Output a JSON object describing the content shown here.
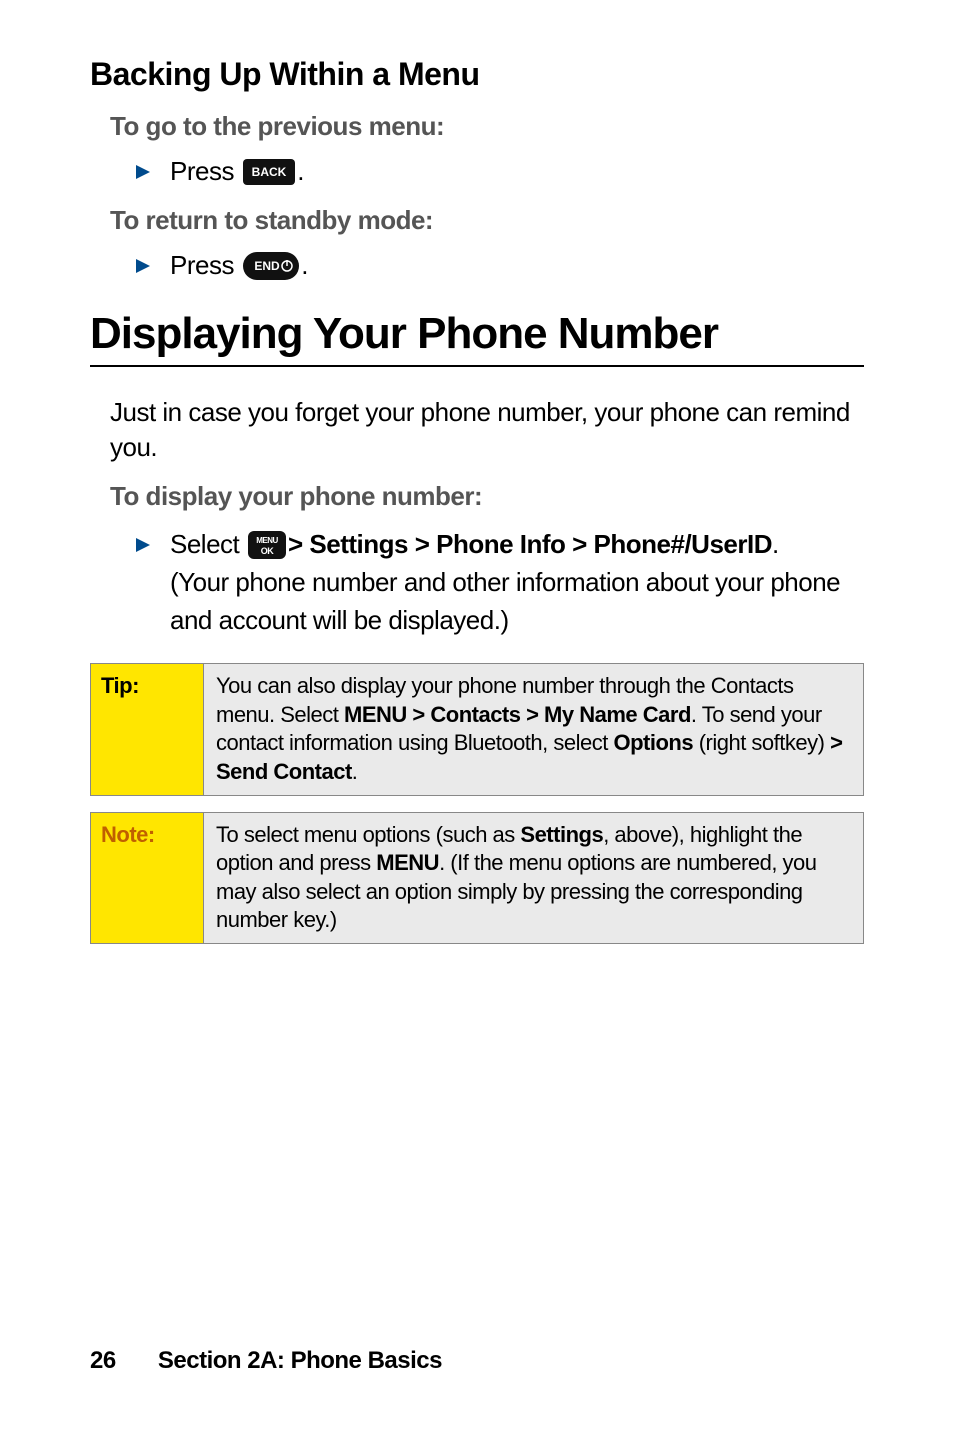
{
  "h3": "Backing Up Within a Menu",
  "prev_label": "To go to the previous menu:",
  "press_word": "Press",
  "period": ".",
  "standby_label": "To return to standby mode:",
  "h1": "Displaying Your Phone Number",
  "intro": "Just in case you forget your phone number, your phone can remind you.",
  "display_label": "To display your phone number:",
  "select_word": "Select",
  "select_path": " > Settings > Phone Info > Phone#/UserID",
  "select_tail": "(Your phone number and other information about your phone and account will be displayed.)",
  "tip": {
    "label": "Tip:",
    "t1": "You can also display your phone number through the Contacts menu. Select ",
    "b1": "MENU > Contacts > My Name Card",
    "t2": ". To send your contact information using Bluetooth, select ",
    "b2": "Options",
    "t3": " (right softkey) ",
    "b3": "> Send Contact",
    "t4": "."
  },
  "note": {
    "label": "Note:",
    "t1": "To select menu options (such as ",
    "b1": "Settings",
    "t2": ", above), highlight the option and press ",
    "b2": "MENU",
    "t3": ". (If the menu options are numbered, you may also select an option simply by pressing the corresponding number key.)"
  },
  "footer": {
    "page": "26",
    "section": "Section 2A: Phone Basics"
  },
  "icons": {
    "back": "BACK",
    "end": "END",
    "menu_top": "MENU",
    "menu_bot": "OK"
  }
}
